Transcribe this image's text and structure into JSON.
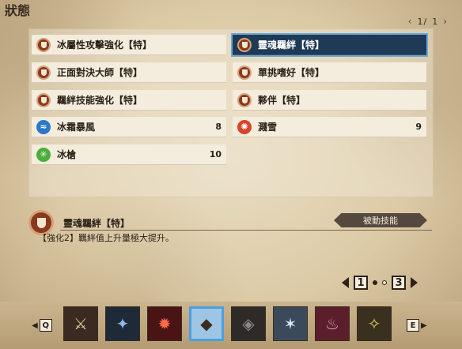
{
  "header": {
    "title": "狀態",
    "page_current": "1/",
    "page_total": "1"
  },
  "skills_left": [
    {
      "name": "冰屬性攻擊強化【特】",
      "icon": "shield-icon",
      "level": ""
    },
    {
      "name": "正面對決大師【特】",
      "icon": "shield-icon",
      "level": ""
    },
    {
      "name": "羈絆技能強化【特】",
      "icon": "shield-icon",
      "level": ""
    },
    {
      "name": "冰霜暴風",
      "icon": "wind-icon",
      "level": "8"
    },
    {
      "name": "冰槍",
      "icon": "ice-lance-icon",
      "level": "10"
    }
  ],
  "skills_right": [
    {
      "name": "靈魂羈絆【特】",
      "icon": "shield-icon",
      "level": "",
      "selected": true
    },
    {
      "name": "單挑嗜好【特】",
      "icon": "shield-icon",
      "level": ""
    },
    {
      "name": "夥伴【特】",
      "icon": "shield-icon",
      "level": ""
    },
    {
      "name": "濺雪",
      "icon": "snow-splash-icon",
      "level": "9"
    }
  ],
  "detail": {
    "name": "靈魂羈絆【特】",
    "tag": "被動技能",
    "description": "【強化2】羈絆值上升量極大提升。"
  },
  "pagination": {
    "left": "1",
    "right": "3"
  },
  "nav": {
    "prev_key": "Q",
    "next_key": "E"
  },
  "monsters": [
    {
      "name": "rider-icon",
      "glyph": "⚔",
      "bg": "#3b2a22"
    },
    {
      "name": "monster-2-icon",
      "glyph": "✦",
      "bg": "#1e2a38"
    },
    {
      "name": "monster-3-icon",
      "glyph": "✹",
      "bg": "#4a1414"
    },
    {
      "name": "monster-4-icon",
      "glyph": "🐗",
      "bg": "#9ec6e4",
      "selected": true
    },
    {
      "name": "monster-5-icon",
      "glyph": "◈",
      "bg": "#2e2a28"
    },
    {
      "name": "monster-6-icon",
      "glyph": "✶",
      "bg": "#3a4a5a"
    },
    {
      "name": "monster-7-icon",
      "glyph": "♨",
      "bg": "#5a1f2a"
    },
    {
      "name": "monster-8-icon",
      "glyph": "✧",
      "bg": "#3a3020"
    }
  ],
  "colors": {
    "selected": "#1f3a57",
    "accent_blue": "#4aa0e0"
  }
}
